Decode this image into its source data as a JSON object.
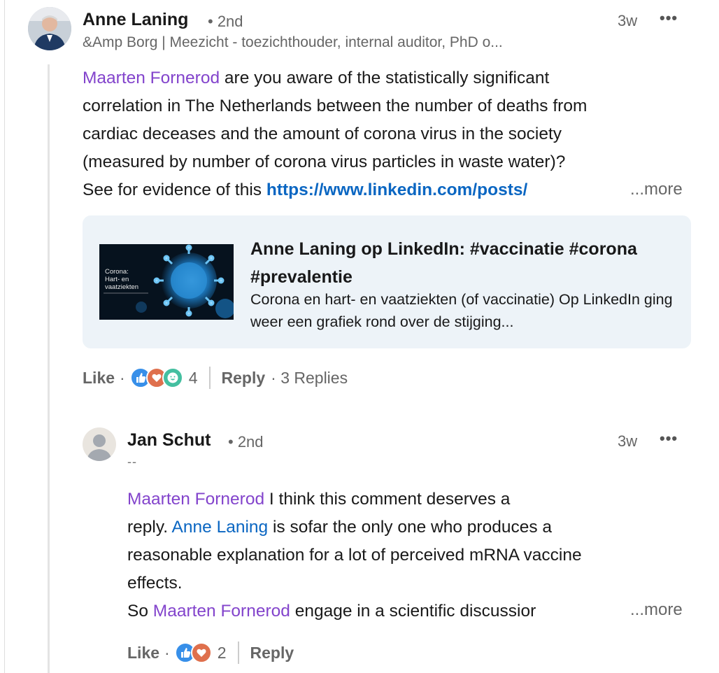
{
  "comment": {
    "author": "Anne Laning",
    "degree": "• 2nd",
    "headline": "&Amp Borg | Meezicht - toezichthouder, internal auditor, PhD o...",
    "time": "3w",
    "body": {
      "mention": "Maarten Fornerod",
      "text_line1": " are you aware of the statistically significant",
      "text_line2": "correlation in The Netherlands between the number of deaths from",
      "text_line3": "cardiac deceases and the amount of corona virus in the society",
      "text_line4": "(measured by number of corona virus particles in waste water)?",
      "text_line5": "See for evidence of this ",
      "link": "https://www.linkedin.com/posts/"
    },
    "more_label": "...more",
    "card": {
      "title": "Anne Laning op LinkedIn: #vaccinatie #corona #prevalentie",
      "description": "Corona en hart- en vaatziekten (of vaccinatie) Op LinkedIn ging weer een grafiek rond over de stijging...",
      "thumb_line1": "Corona:",
      "thumb_line2": "Hart- en",
      "thumb_line3": "vaatziekten"
    },
    "actions": {
      "like": "Like",
      "dot": "·",
      "reaction_count": "4",
      "reply": "Reply",
      "replies": "· 3 Replies"
    }
  },
  "reply": {
    "author": "Jan Schut",
    "degree": "• 2nd",
    "headline": "--",
    "time": "3w",
    "body": {
      "mention1": "Maarten Fornerod",
      "text1": " I think this comment deserves a",
      "text2": "reply. ",
      "mention2": "Anne Laning",
      "text3": " is sofar the only one who produces a",
      "text4": "reasonable explanation for a lot of perceived mRNA vaccine",
      "text5": "effects.",
      "text6": "So ",
      "mention3": "Maarten Fornerod",
      "text7": " engage in a scientific discussior"
    },
    "more_label": "...more",
    "actions": {
      "like": "Like",
      "dot": "·",
      "reaction_count": "2",
      "reply": "Reply"
    }
  },
  "colors": {
    "mention_purple": "#8344cc",
    "link_blue": "#0a66c2",
    "card_bg": "#edf3f8",
    "like_blue": "#378fe9",
    "love_red": "#df704d",
    "insightful_teal": "#44bfa0"
  },
  "icons": {
    "overflow": "ellipsis-icon",
    "reaction_like": "thumbs-up-icon",
    "reaction_love": "heart-icon",
    "reaction_funny": "laugh-icon"
  }
}
